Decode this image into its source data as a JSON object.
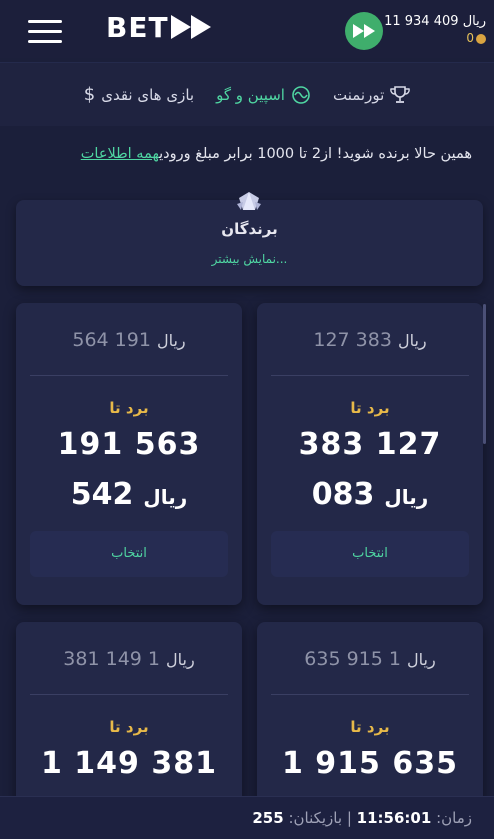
{
  "header": {
    "logo": "BET",
    "balance": "ریال 409 934 11",
    "bonus": "0"
  },
  "tabs": [
    {
      "label": "تورنمنت",
      "icon": "trophy-icon"
    },
    {
      "label": "اسپین و گو",
      "icon": "spin-icon"
    },
    {
      "label": "بازی های نقدی",
      "icon": "dollar-icon"
    }
  ],
  "info": {
    "text": "همین حالا برنده شوید! از2 تا 1000 برابر مبلغ ورودی",
    "link": "همه اطلاعات"
  },
  "winners": {
    "title": "برندگان",
    "more": "نمایش بیشتر..."
  },
  "cards": [
    {
      "pool_currency": "ریال",
      "pool_amount": "383 127",
      "win_label": "برد تا",
      "win_line1": "383 127",
      "win_line2": "083",
      "win_currency": "ریال",
      "select_label": "انتخاب"
    },
    {
      "pool_currency": "ریال",
      "pool_amount": "191 564",
      "win_label": "برد تا",
      "win_line1": "191 563",
      "win_line2": "542",
      "win_currency": "ریال",
      "select_label": "انتخاب"
    },
    {
      "pool_currency": "ریال",
      "pool_amount": "1 915 635",
      "win_label": "برد تا",
      "win_line1": "1 915 635"
    },
    {
      "pool_currency": "ریال",
      "pool_amount": "1 149 381",
      "win_label": "برد تا",
      "win_line1": "1 149 381"
    }
  ],
  "footer": {
    "time_label": "زمان:",
    "time": "11:56:01",
    "players_label": "بازیکنان:",
    "players": "255"
  },
  "colors": {
    "background": "#1b1f3a",
    "accent": "#4fd6a2",
    "gold": "#e7b949",
    "card": "#232848"
  }
}
